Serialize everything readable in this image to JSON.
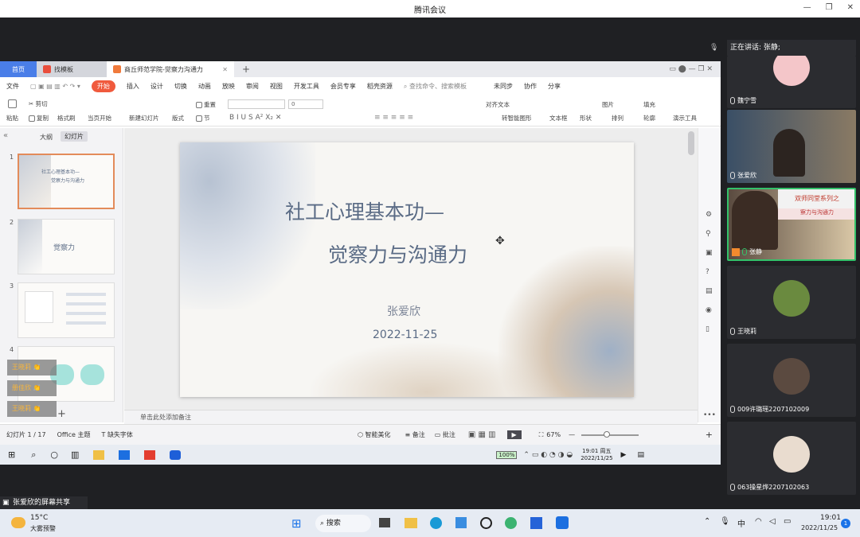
{
  "window": {
    "title": "腾讯会议"
  },
  "wps": {
    "tabs": [
      {
        "label": "首页"
      },
      {
        "label": "找模板"
      },
      {
        "label": "商丘师范学院-觉察力沟通力"
      }
    ],
    "menu": [
      "文件",
      "开始",
      "插入",
      "设计",
      "切换",
      "动画",
      "放映",
      "审阅",
      "视图",
      "开发工具",
      "会员专享",
      "稻壳资源"
    ],
    "search_placeholder": "查找命令、搜索模板",
    "sync": "未同步",
    "collab": "协作",
    "share": "分享",
    "toolbar": {
      "paste": "粘贴",
      "cut": "剪切",
      "copy": "复制",
      "format_painter": "格式刷",
      "start_from_current": "当页开始",
      "new_slide": "新建幻灯片",
      "layout": "版式",
      "section": "节",
      "reset": "重置",
      "font_size": "0",
      "align_text": "对齐文本",
      "smart_graphic": "转智能图形",
      "textbox": "文本框",
      "shape": "形状",
      "picture": "图片",
      "arrange": "排列",
      "fill": "填充",
      "outline": "轮廓",
      "presentation_tools": "演示工具"
    },
    "panel_tabs": [
      "大纲",
      "幻灯片"
    ],
    "thumbs": [
      {
        "num": "1",
        "line1": "社工心理基本功—",
        "line2": "觉察力与沟通力"
      },
      {
        "num": "2",
        "text": "觉察力"
      },
      {
        "num": "3"
      },
      {
        "num": "4"
      }
    ],
    "slide": {
      "title1": "社工心理基本功—",
      "title2": "觉察力与沟通力",
      "author": "张爱欣",
      "date": "2022-11-25"
    },
    "notes_placeholder": "单击此处添加备注",
    "status": {
      "slide_count": "幻灯片 1 / 17",
      "theme": "Office 主题",
      "missing_font": "缺失字体",
      "beautify": "智能美化",
      "notes": "备注",
      "comment": "批注",
      "zoom": "67%"
    }
  },
  "inner_taskbar": {
    "battery": "100%",
    "time": "19:01 周五",
    "date": "2022/11/25"
  },
  "reactions": [
    {
      "name": "王晓莉"
    },
    {
      "name": "册佳欣"
    },
    {
      "name": "王晓莉"
    }
  ],
  "meeting": {
    "speaking": "正在讲话: 张静;",
    "participants": [
      {
        "name": "魏宁雪"
      },
      {
        "name": "张爱欣"
      },
      {
        "name": "张静"
      },
      {
        "name": "王晓莉"
      },
      {
        "name": "009许璐瑶2207102009"
      },
      {
        "name": "063操星烨2207102063"
      }
    ],
    "share_label": "张爱欣的屏幕共享"
  },
  "slide2_banner": "双师同堂系列之",
  "slide2_sub": "察力与沟通力",
  "taskbar": {
    "temp": "15°C",
    "weather": "大雾预警",
    "search": "搜索",
    "ime": "中",
    "time": "19:01",
    "date": "2022/11/25",
    "badge": "1"
  },
  "colors": {
    "accent": "#4a7ee8",
    "wps_red": "#f05a3d",
    "slide_text": "#5a6b85"
  }
}
